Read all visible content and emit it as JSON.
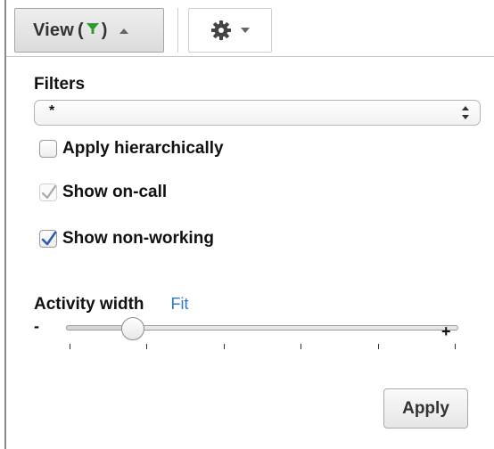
{
  "toolbar": {
    "view_label": "View",
    "view_open_paren": "(",
    "view_close_paren": ")",
    "funnel_icon": "funnel-icon",
    "funnel_color": "#2e9b2e",
    "gear_icon": "gear-icon"
  },
  "filters": {
    "label": "Filters",
    "selected_value": "*"
  },
  "options": [
    {
      "label": "Apply hierarchically",
      "checked": false,
      "disabled": false
    },
    {
      "label": "Show on-call",
      "checked": true,
      "disabled": true
    },
    {
      "label": "Show non-working",
      "checked": true,
      "disabled": false
    }
  ],
  "activity_width": {
    "label": "Activity width",
    "fit_label": "Fit",
    "min_label": "-",
    "max_label": "+",
    "tick_count": 6,
    "value_fraction": 0.17
  },
  "apply_label": "Apply",
  "colors": {
    "link": "#2b7bd3",
    "check_blue": "#2a5db0",
    "check_disabled": "#a9a9a9"
  }
}
